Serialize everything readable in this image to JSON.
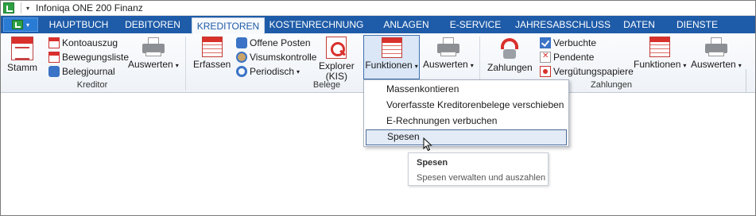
{
  "window": {
    "title": "Infoniqa ONE 200 Finanz"
  },
  "tabs": [
    {
      "label": "HAUPTBUCH"
    },
    {
      "label": "DEBITOREN"
    },
    {
      "label": "KREDITOREN"
    },
    {
      "label": "KOSTENRECHNUNG"
    },
    {
      "label": "ANLAGEN"
    },
    {
      "label": "E-SERVICE"
    },
    {
      "label": "JAHRESABSCHLUSS"
    },
    {
      "label": "DATEN"
    },
    {
      "label": "DIENSTE"
    }
  ],
  "active_tab": "KREDITOREN",
  "ribbon": {
    "kreditor": {
      "label": "Kreditor",
      "stamm": "Stamm",
      "kontoauszug": "Kontoauszug",
      "bewegungsliste": "Bewegungsliste",
      "belegjournal": "Belegjournal",
      "auswerten": "Auswerten"
    },
    "belege": {
      "label": "Belege",
      "erfassen": "Erfassen",
      "offene_posten": "Offene Posten",
      "visumskontrolle": "Visumskontrolle",
      "periodisch": "Periodisch",
      "explorer_line1": "Explorer",
      "explorer_line2": "(KIS)",
      "funktionen": "Funktionen",
      "auswerten": "Auswerten"
    },
    "zahlungen": {
      "label": "Zahlungen",
      "zahlungen": "Zahlungen",
      "verbuchte": "Verbuchte",
      "pendente": "Pendente",
      "verguetungspapiere": "Vergütungspapiere",
      "funktionen": "Funktionen",
      "auswerten": "Auswerten"
    }
  },
  "menu": {
    "items": [
      {
        "label": "Massenkontieren"
      },
      {
        "label": "Vorerfasste Kreditorenbelege verschieben"
      },
      {
        "label": "E-Rechnungen verbuchen"
      },
      {
        "label": "Spesen"
      }
    ],
    "highlighted": "Spesen"
  },
  "tooltip": {
    "title": "Spesen",
    "text": "Spesen verwalten und auszahlen"
  },
  "colors": {
    "tab_bar": "#1e5ba8",
    "accent_red": "#d9302c",
    "menu_highlight": "#e3ebf6"
  }
}
